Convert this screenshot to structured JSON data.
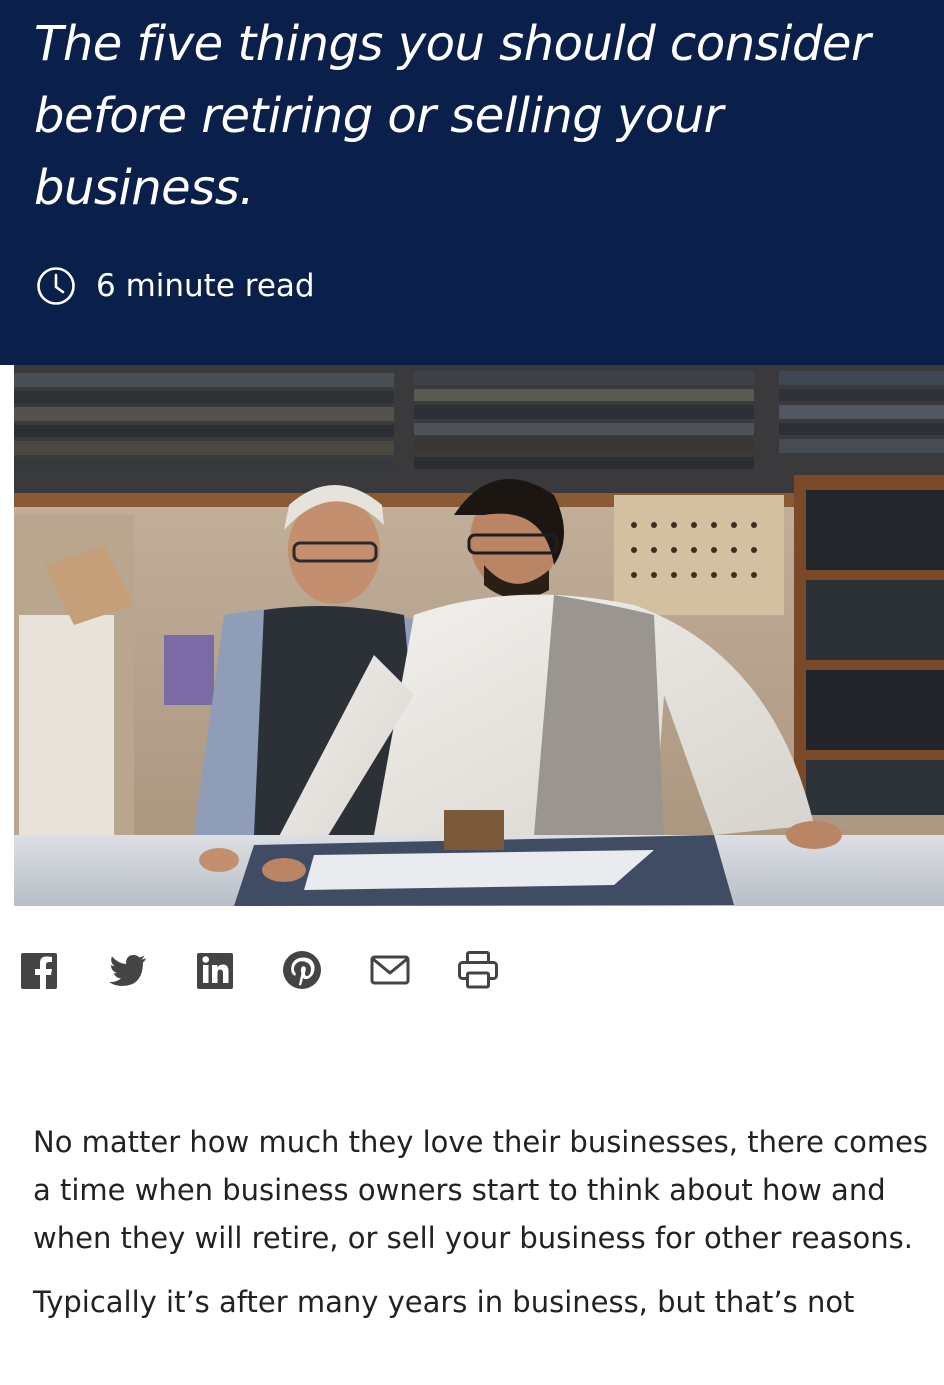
{
  "article": {
    "title": "The five things you should consider before retiring or selling your business.",
    "read_time": "6 minute read",
    "paragraphs": [
      "No matter how much they love their businesses, there comes a time when business owners start to think about how and when they will retire, or sell your business for other reasons.",
      "Typically it’s after many years in business, but that’s not"
    ]
  },
  "share": {
    "icons": [
      "facebook-icon",
      "twitter-icon",
      "linkedin-icon",
      "pinterest-icon",
      "email-icon",
      "print-icon"
    ]
  },
  "colors": {
    "hero_background": "#0b1f4b",
    "hero_text": "#ffffff",
    "share_icon": "#444444",
    "body_text": "#222222"
  }
}
